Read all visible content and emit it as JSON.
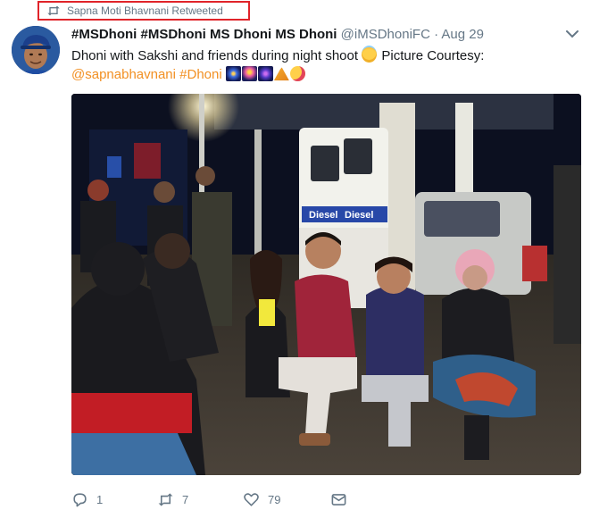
{
  "retweet_context": {
    "text": "Sapna Moti Bhavnani Retweeted",
    "icon": "retweet-icon"
  },
  "author": {
    "name": "#MSDhoni #MSDhoni MS Dhoni MS Dhoni",
    "handle": "@iMSDhoniFC",
    "separator": "·",
    "date": "Aug 29"
  },
  "tweet": {
    "text_main": "Dhoni with Sakshi and friends during night shoot",
    "text_after_emoji": " Picture Courtesy:",
    "mention": "@sapnabhavnani",
    "hashtag": "#Dhoni",
    "emojis": [
      "smiling-face-with-halo",
      "fireworks",
      "sparkler",
      "fireworks",
      "tent",
      "face-blowing-kiss"
    ]
  },
  "photo": {
    "alt_subject": "group seated at fuel pump at night",
    "pump_labels": [
      "Diesel",
      "Diesel"
    ]
  },
  "actions": {
    "reply_count": "1",
    "retweet_count": "7",
    "like_count": "79"
  },
  "colors": {
    "link": "#f29023",
    "muted": "#657786",
    "highlight_border": "#e0242a",
    "retweet_green": "#17bf63"
  }
}
